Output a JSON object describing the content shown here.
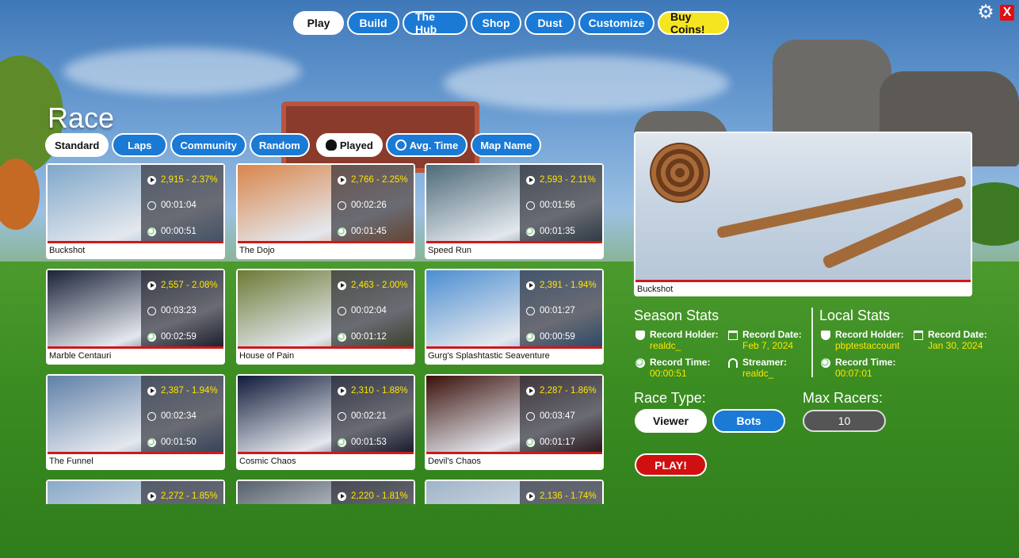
{
  "nav": {
    "items": [
      "Play",
      "Build",
      "The Hub",
      "Shop",
      "Dust",
      "Customize",
      "Buy Coins!"
    ],
    "active": "Play",
    "settings_icon": "gear-icon",
    "close_label": "X"
  },
  "page_title": "Race",
  "filters": {
    "items": [
      "Standard",
      "Laps",
      "Community",
      "Random",
      "Played",
      "Avg. Time",
      "Map Name"
    ],
    "active": "Standard"
  },
  "tracks": [
    {
      "name": "Buckshot",
      "plays": "2,915 - 2.37%",
      "avg_time": "00:01:04",
      "record": "00:00:51",
      "art": "#7fa7c9"
    },
    {
      "name": "The Dojo",
      "plays": "2,766 - 2.25%",
      "avg_time": "00:02:26",
      "record": "00:01:45",
      "art": "#d9854a"
    },
    {
      "name": "Speed Run",
      "plays": "2,593 - 2.11%",
      "avg_time": "00:01:56",
      "record": "00:01:35",
      "art": "#4d6a78"
    },
    {
      "name": "Marble Centauri",
      "plays": "2,557 - 2.08%",
      "avg_time": "00:03:23",
      "record": "00:02:59",
      "art": "#1b2238"
    },
    {
      "name": "House of Pain",
      "plays": "2,463 - 2.00%",
      "avg_time": "00:02:04",
      "record": "00:01:12",
      "art": "#6c7a35"
    },
    {
      "name": "Gurg's Splashtastic Seaventure",
      "plays": "2,391 - 1.94%",
      "avg_time": "00:01:27",
      "record": "00:00:59",
      "art": "#4b8ed1"
    },
    {
      "name": "The Funnel",
      "plays": "2,387 - 1.94%",
      "avg_time": "00:02:34",
      "record": "00:01:50",
      "art": "#5f7fa8"
    },
    {
      "name": "Cosmic Chaos",
      "plays": "2,310 - 1.88%",
      "avg_time": "00:02:21",
      "record": "00:01:53",
      "art": "#101a3a"
    },
    {
      "name": "Devil's Chaos",
      "plays": "2,287 - 1.86%",
      "avg_time": "00:03:47",
      "record": "00:01:17",
      "art": "#3a0f0a"
    },
    {
      "name": "",
      "plays": "2,272 - 1.85%",
      "avg_time": "",
      "record": "",
      "art": "#8aa9c8"
    },
    {
      "name": "",
      "plays": "2,220 - 1.81%",
      "avg_time": "",
      "record": "",
      "art": "#56606a"
    },
    {
      "name": "",
      "plays": "2,136 - 1.74%",
      "avg_time": "",
      "record": "",
      "art": "#9fb4c8"
    }
  ],
  "preview": {
    "name": "Buckshot"
  },
  "season_stats": {
    "title": "Season Stats",
    "record_holder_label": "Record Holder:",
    "record_holder": "realdc_",
    "record_date_label": "Record Date:",
    "record_date": "Feb 7, 2024",
    "record_time_label": "Record Time:",
    "record_time": "00:00:51",
    "streamer_label": "Streamer:",
    "streamer": "realdc_"
  },
  "local_stats": {
    "title": "Local Stats",
    "record_holder_label": "Record Holder:",
    "record_holder": "pbptestaccount",
    "record_date_label": "Record Date:",
    "record_date": "Jan 30, 2024",
    "record_time_label": "Record Time:",
    "record_time": "00:07:01"
  },
  "race_type": {
    "label": "Race Type:",
    "options": [
      "Viewer",
      "Bots"
    ],
    "selected": "Bots"
  },
  "max_racers": {
    "label": "Max Racers:",
    "value": "10"
  },
  "play_button": "PLAY!"
}
